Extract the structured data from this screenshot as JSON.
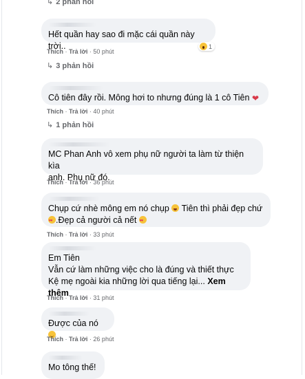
{
  "top_replies": {
    "arrow": "↳",
    "label": "2 phản hồi"
  },
  "comments": [
    {
      "text": "Hết quần hay sao đi mặc cái quần này trời..",
      "like": "Thích",
      "reply": "Trả lời",
      "time": "50 phút",
      "reaction_count": "1",
      "replies_label": "3 phản hồi"
    },
    {
      "text": "Cô tiên đây rồi. Mông hơi to nhưng đúng là 1 cô Tiên",
      "like": "Thích",
      "reply": "Trả lời",
      "time": "40 phút",
      "replies_label": "1 phản hồi"
    },
    {
      "line1": "MC Phan Anh vô xem phụ nữ người ta làm từ thiện kìa",
      "line2": "anh. Phụ nữ đó.",
      "like": "Thích",
      "reply": "Trả lời",
      "time": "36 phút"
    },
    {
      "line1": "Chụp cứ nhè mông em nó chụp",
      "line1b": "Tiên thì phải đẹp chứ",
      "line2": ".Đẹp cả người cả nết",
      "like": "Thích",
      "reply": "Trả lời",
      "time": "33 phút"
    },
    {
      "line1": "Em Tiên",
      "line2": "Vẫn cứ làm những việc cho là đúng và thiết thực",
      "line3": "Kệ mẹ ngoài kia những lời qua tiếng lại...",
      "see_more": "Xem thêm",
      "like": "Thích",
      "reply": "Trả lời",
      "time": "31 phút"
    },
    {
      "text": "Được của nó",
      "like": "Thích",
      "reply": "Trả lời",
      "time": "26 phút"
    },
    {
      "text": "Mo tông thế!"
    }
  ],
  "reply_arrow": "↳",
  "colors": {
    "bubble": "#f0f2f5",
    "meta": "#65676b",
    "text": "#050505"
  }
}
